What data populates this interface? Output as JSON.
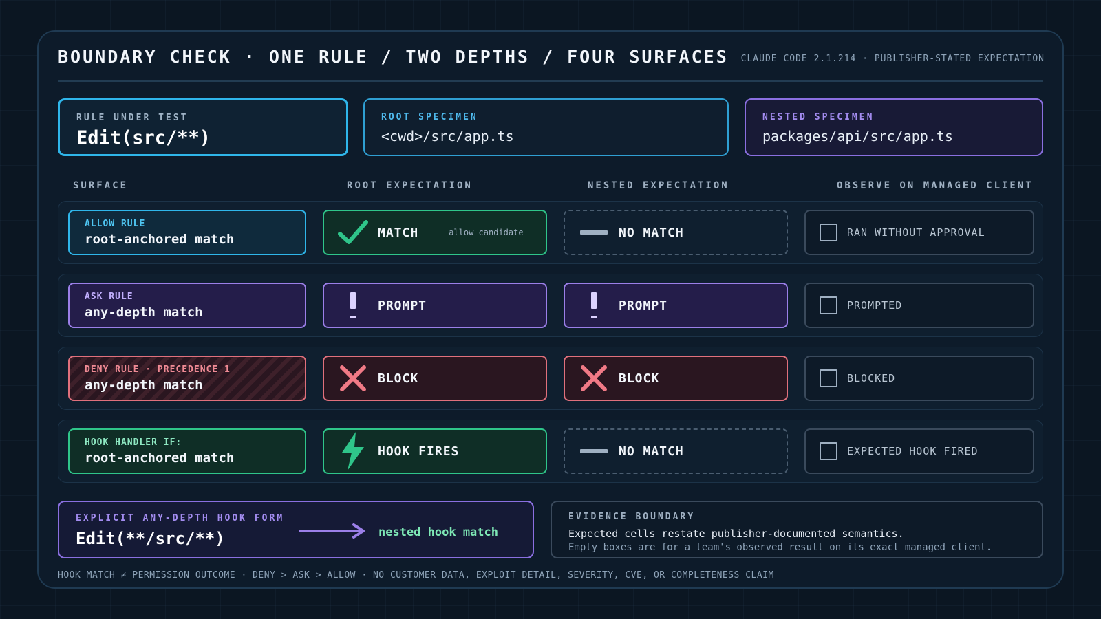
{
  "header": {
    "title": "BOUNDARY CHECK · ONE RULE / TWO DEPTHS / FOUR SURFACES",
    "meta": "CLAUDE CODE 2.1.214 · PUBLISHER-STATED EXPECTATION"
  },
  "specimens": {
    "rule": {
      "label": "RULE UNDER TEST",
      "value": "Edit(src/**)"
    },
    "root": {
      "label": "ROOT SPECIMEN",
      "value": "<cwd>/src/app.ts"
    },
    "nested": {
      "label": "NESTED SPECIMEN",
      "value": "packages/api/src/app.ts"
    }
  },
  "columns": {
    "surface": "SURFACE",
    "root": "ROOT EXPECTATION",
    "nested": "NESTED EXPECTATION",
    "observe": "OBSERVE ON MANAGED CLIENT"
  },
  "rows": [
    {
      "surface_label": "ALLOW RULE",
      "surface_value": "root-anchored match",
      "root": {
        "icon": "check-icon",
        "word": "MATCH",
        "note": "allow candidate"
      },
      "nested": {
        "icon": "dash-icon",
        "word": "NO MATCH"
      },
      "observe": "RAN WITHOUT APPROVAL"
    },
    {
      "surface_label": "ASK RULE",
      "surface_value": "any-depth match",
      "root": {
        "icon": "exclamation-icon",
        "word": "PROMPT"
      },
      "nested": {
        "icon": "exclamation-icon",
        "word": "PROMPT"
      },
      "observe": "PROMPTED"
    },
    {
      "surface_label": "DENY RULE · PRECEDENCE 1",
      "surface_value": "any-depth match",
      "root": {
        "icon": "x-icon",
        "word": "BLOCK"
      },
      "nested": {
        "icon": "x-icon",
        "word": "BLOCK"
      },
      "observe": "BLOCKED"
    },
    {
      "surface_label": "HOOK HANDLER IF:",
      "surface_value": "root-anchored match",
      "root": {
        "icon": "lightning-icon",
        "word": "HOOK FIRES"
      },
      "nested": {
        "icon": "dash-icon",
        "word": "NO MATCH"
      },
      "observe": "EXPECTED HOOK FIRED"
    }
  ],
  "hook_form": {
    "label": "EXPLICIT ANY-DEPTH HOOK FORM",
    "value": "Edit(**/src/**)",
    "arrow_icon": "arrow-right-icon",
    "result": "nested hook match"
  },
  "evidence": {
    "label": "EVIDENCE BOUNDARY",
    "line1": "Expected cells restate publisher-documented semantics.",
    "line2": "Empty boxes are for a team's observed result on its exact managed client."
  },
  "footer": "HOOK MATCH ≠ PERMISSION OUTCOME · DENY > ASK > ALLOW · NO CUSTOMER DATA, EXPLOIT DETAIL, SEVERITY, CVE, OR COMPLETENESS CLAIM",
  "colors": {
    "cyan": "#2fb6ea",
    "purple": "#9b7fe8",
    "red": "#e0707c",
    "green": "#2fc58a"
  }
}
